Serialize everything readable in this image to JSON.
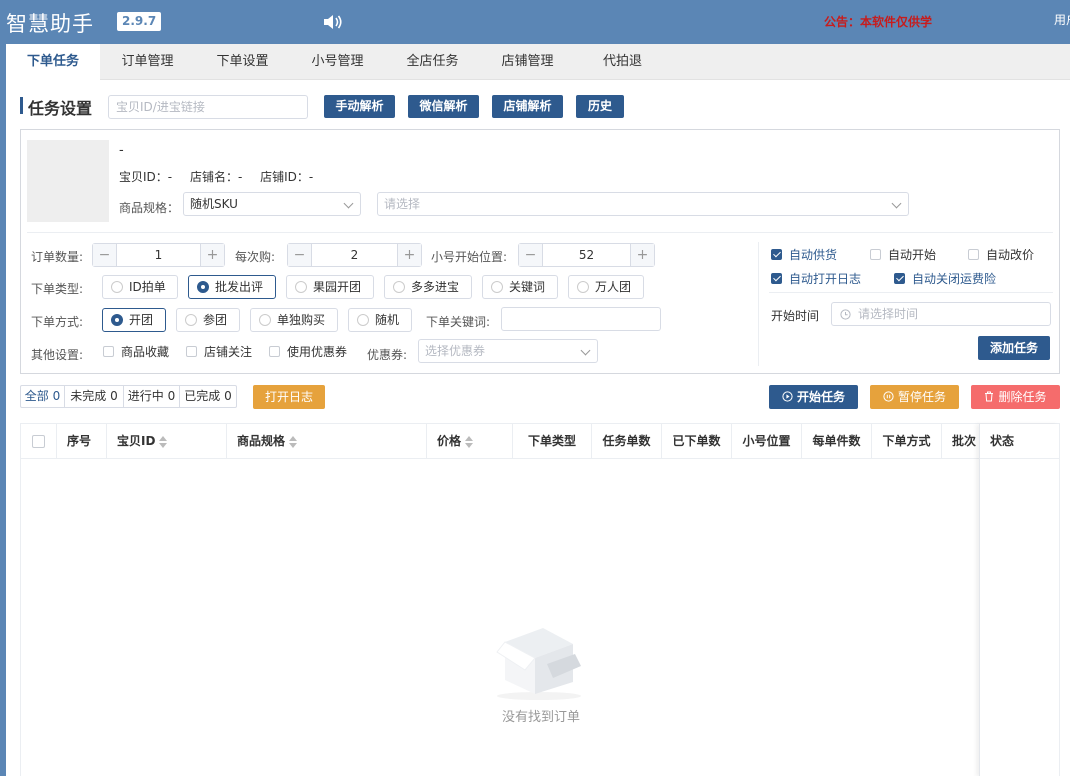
{
  "app": {
    "title": "智慧助手",
    "version": "2.9.7",
    "notice": "公告：本软件仅供学",
    "user_truncated": "用户"
  },
  "colors": {
    "accent": "#2e5a8e",
    "header": "#5b86b5",
    "notice": "#c71c1c",
    "orange": "#e6a23c",
    "red": "#f56c6c"
  },
  "tabs": [
    {
      "label": "下单任务",
      "active": true
    },
    {
      "label": "订单管理"
    },
    {
      "label": "下单设置"
    },
    {
      "label": "小号管理"
    },
    {
      "label": "全店任务"
    },
    {
      "label": "店铺管理"
    },
    {
      "label": "代拍退"
    }
  ],
  "task_settings": {
    "title": "任务设置",
    "link_placeholder": "宝贝ID/进宝链接",
    "buttons": [
      "手动解析",
      "微信解析",
      "店铺解析",
      "历史"
    ]
  },
  "product": {
    "name": "-",
    "item_id_label": "宝贝ID：-",
    "shop_name_label": "店铺名：-",
    "shop_id_label": "店铺ID：-",
    "spec_label": "商品规格：",
    "spec_value": "随机SKU",
    "spec_placeholder": "请选择"
  },
  "form": {
    "order_qty_label": "订单数量:",
    "order_qty": "1",
    "per_buy_label": "每次购:",
    "per_buy": "2",
    "start_pos_label": "小号开始位置:",
    "start_pos": "52",
    "order_type_label": "下单类型:",
    "order_types": [
      {
        "label": "ID拍单"
      },
      {
        "label": "批发出评",
        "selected": true
      },
      {
        "label": "果园开团"
      },
      {
        "label": "多多进宝"
      },
      {
        "label": "关键词"
      },
      {
        "label": "万人团"
      }
    ],
    "order_mode_label": "下单方式:",
    "order_modes": [
      {
        "label": "开团",
        "selected": true
      },
      {
        "label": "参团"
      },
      {
        "label": "单独购买"
      },
      {
        "label": "随机"
      }
    ],
    "keyword_label": "下单关键词:",
    "other_label": "其他设置:",
    "other_options": [
      "商品收藏",
      "店铺关注",
      "使用优惠券"
    ],
    "coupon_label": "优惠券:",
    "coupon_placeholder": "选择优惠券"
  },
  "auto_options": [
    {
      "label": "自动供货",
      "checked": true
    },
    {
      "label": "自动开始",
      "checked": false
    },
    {
      "label": "自动改价",
      "checked": false
    },
    {
      "label": "自动打开日志",
      "checked": true
    },
    {
      "label": "自动关闭运费险",
      "checked": true
    }
  ],
  "start_time": {
    "label": "开始时间",
    "placeholder": "请选择时间"
  },
  "add_task_label": "添加任务",
  "filters": [
    {
      "label": "全部 0",
      "active": true
    },
    {
      "label": "未完成 0"
    },
    {
      "label": "进行中 0"
    },
    {
      "label": "已完成 0"
    }
  ],
  "open_log_label": "打开日志",
  "actions": {
    "start": "开始任务",
    "pause": "暂停任务",
    "delete": "删除任务"
  },
  "table": {
    "columns": [
      "序号",
      "宝贝ID",
      "商品规格",
      "价格",
      "下单类型",
      "任务单数",
      "已下单数",
      "小号位置",
      "每单件数",
      "下单方式",
      "批次",
      "状态"
    ],
    "empty_text": "没有找到订单"
  }
}
